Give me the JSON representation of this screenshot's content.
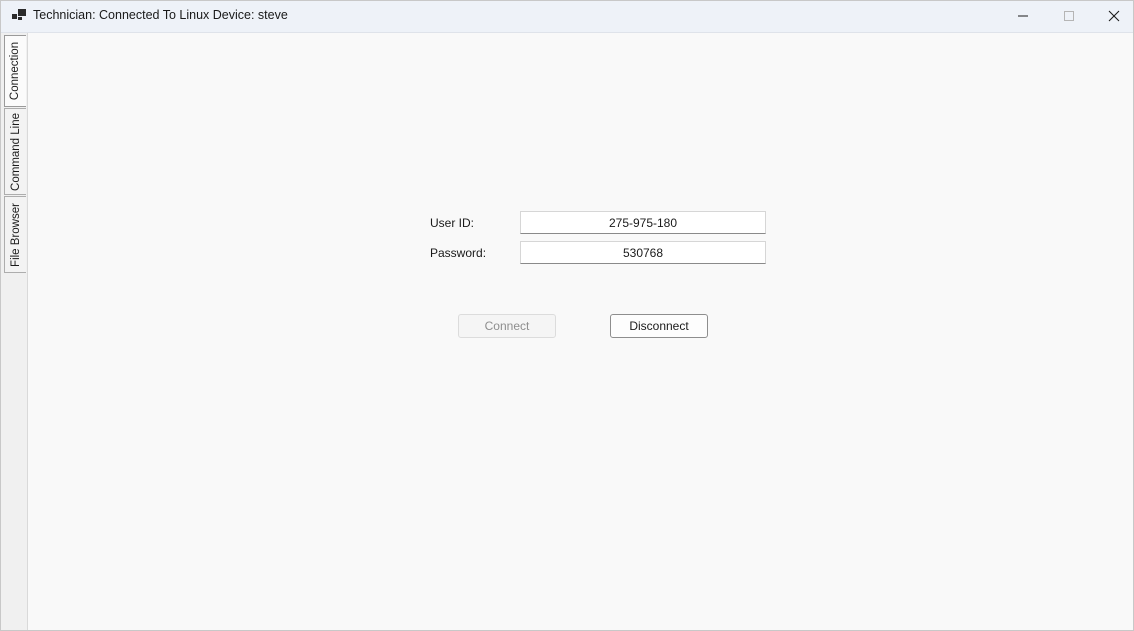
{
  "window": {
    "title": "Technician: Connected To Linux Device: steve",
    "icon": "app-window-icon",
    "controls": {
      "minimize_icon": "minimize-icon",
      "maximize_icon": "maximize-icon",
      "close_icon": "close-icon"
    }
  },
  "tabs": [
    {
      "label": "Connection",
      "active": true
    },
    {
      "label": "Command Line",
      "active": false
    },
    {
      "label": "File Browser",
      "active": false
    }
  ],
  "form": {
    "user_id_label": "User ID:",
    "user_id_value": "275-975-180",
    "password_label": "Password:",
    "password_value": "530768"
  },
  "buttons": {
    "connect_label": "Connect",
    "connect_enabled": false,
    "disconnect_label": "Disconnect",
    "disconnect_enabled": true
  }
}
